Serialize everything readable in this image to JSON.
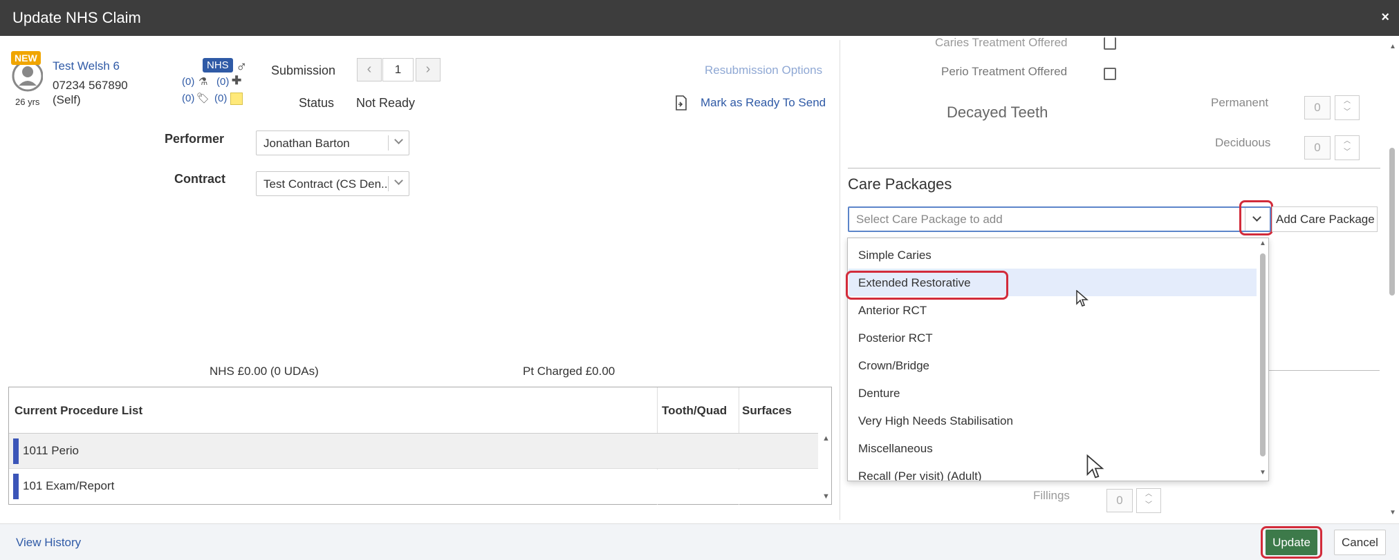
{
  "dialog": {
    "title": "Update NHS Claim",
    "close": "×"
  },
  "patient": {
    "badge": "NEW",
    "name": "Test Welsh 6",
    "phone": "07234 567890",
    "relation": "(Self)",
    "age": "26 yrs",
    "nhs_badge": "NHS",
    "count_lab": "(0)",
    "count_plus": "(0)",
    "count_tag": "(0)",
    "count_note": "(0)"
  },
  "submission": {
    "label": "Submission",
    "value": "1",
    "status_label": "Status",
    "status_value": "Not Ready"
  },
  "actions": {
    "resubmission": "Resubmission Options",
    "mark_ready": "Mark as Ready To Send"
  },
  "performer": {
    "label": "Performer",
    "value": "Jonathan Barton"
  },
  "contract": {
    "label": "Contract",
    "value": "Test Contract (CS Den..."
  },
  "totals": {
    "nhs": "NHS £0.00 (0 UDAs)",
    "pt": "Pt Charged £0.00"
  },
  "procedures": {
    "headers": {
      "list": "Current Procedure List",
      "tooth": "Tooth/Quad",
      "surfaces": "Surfaces"
    },
    "rows": [
      {
        "name": "1011 Perio"
      },
      {
        "name": "101 Exam/Report"
      }
    ]
  },
  "right_panel": {
    "caries_offered": "Caries Treatment Offered",
    "perio_offered": "Perio Treatment Offered",
    "decayed_teeth": "Decayed Teeth",
    "permanent": "Permanent",
    "permanent_value": "0",
    "deciduous": "Deciduous",
    "deciduous_value": "0",
    "care_packages_title": "Care Packages",
    "select_placeholder": "Select Care Package to add",
    "add_button": "Add Care Package",
    "fillings": "Fillings",
    "fillings_value": "0"
  },
  "dropdown": {
    "items": [
      "Simple Caries",
      "Extended Restorative",
      "Anterior RCT",
      "Posterior RCT",
      "Crown/Bridge",
      "Denture",
      "Very High Needs Stabilisation",
      "Miscellaneous",
      "Recall (Per visit) (Adult)"
    ],
    "highlighted_index": 1
  },
  "footer": {
    "history": "View History",
    "update": "Update",
    "cancel": "Cancel"
  },
  "colors": {
    "titlebar": "#3d3d3d",
    "link": "#2f5aa6",
    "update_green": "#3d7a4a",
    "highlight_red": "#d22b3a",
    "nhs_blue": "#2f5aa6"
  }
}
